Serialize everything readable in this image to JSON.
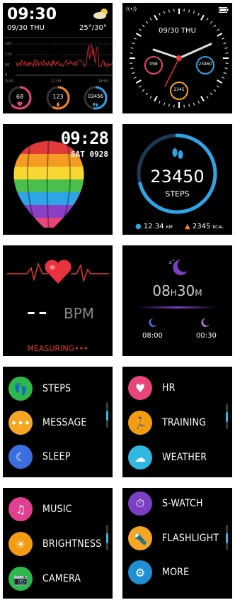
{
  "tile1": {
    "time": "09:30",
    "date": "09/30 THU",
    "weather_icon": "cloud-sun-icon",
    "temp": "25°/30°",
    "chart_y_labels": [
      "180",
      "120",
      "60",
      "0"
    ],
    "chart_x_labels": [
      "6:00",
      "12:00",
      "18:00"
    ],
    "heart": "68",
    "calories": "123",
    "steps": "03456"
  },
  "tile2": {
    "signal_icon": "wifi-signal-icon",
    "battery_icon": "battery-icon",
    "date": "09/30 THU",
    "heart": "098",
    "steps": "23460",
    "calories": "2345"
  },
  "tile3": {
    "time": "09:28",
    "date": "SAT 0928"
  },
  "tile4": {
    "steps_value": "23450",
    "steps_label": "STEPS",
    "distance": "12.34",
    "distance_unit": "KM",
    "calories": "2345",
    "calories_unit": "KCAL"
  },
  "tile5": {
    "bpm_value": "– –",
    "bpm_label": "BPM",
    "status": "MEASURING•••"
  },
  "tile6": {
    "hours": "08",
    "h": "H",
    "minutes": "30",
    "m": "M",
    "start": "08:00",
    "end": "00:30"
  },
  "menu1": {
    "items": [
      {
        "label": "STEPS",
        "icon": "footsteps-icon",
        "color": "#2db84b"
      },
      {
        "label": "MESSAGE",
        "icon": "chat-bubble-icon",
        "color": "#f5a623"
      },
      {
        "label": "SLEEP",
        "icon": "moon-icon",
        "color": "#3b6fe0"
      }
    ]
  },
  "menu2": {
    "items": [
      {
        "label": "HR",
        "icon": "heart-icon",
        "color": "#e8457a"
      },
      {
        "label": "TRAINING",
        "icon": "running-icon",
        "color": "#f39c12"
      },
      {
        "label": "WEATHER",
        "icon": "cloud-icon",
        "color": "#2fb8e0"
      }
    ]
  },
  "menu3": {
    "items": [
      {
        "label": "MUSIC",
        "icon": "music-note-icon",
        "color": "#e0408f"
      },
      {
        "label": "BRIGHTNESS",
        "icon": "sun-icon",
        "color": "#f39c12"
      },
      {
        "label": "CAMERA",
        "icon": "camera-icon",
        "color": "#2db84b"
      }
    ]
  },
  "menu4": {
    "items": [
      {
        "label": "S-WATCH",
        "icon": "stopwatch-icon",
        "color": "#7b3fc4"
      },
      {
        "label": "FLASHLIGHT",
        "icon": "flashlight-icon",
        "color": "#f5a623"
      },
      {
        "label": "MORE",
        "icon": "gear-icon",
        "color": "#1f8fd6"
      }
    ]
  }
}
